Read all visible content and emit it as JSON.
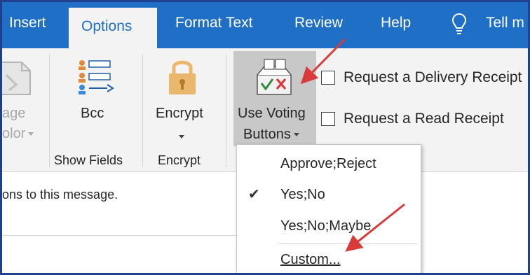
{
  "tabs": [
    {
      "label": "Insert"
    },
    {
      "label": "Options"
    },
    {
      "label": "Format Text"
    },
    {
      "label": "Review"
    },
    {
      "label": "Help"
    }
  ],
  "tell_me": "Tell m",
  "ribbon": {
    "page_color_line1": "age",
    "page_color_line2": "olor",
    "bcc_label": "Bcc",
    "show_fields_group": "Show Fields",
    "encrypt_label": "Encrypt",
    "encrypt_group": "Encrypt",
    "voting_line1": "Use Voting",
    "voting_line2": "Buttons",
    "delivery_receipt": "Request a Delivery Receipt",
    "read_receipt": "Request a Read Receipt"
  },
  "message_body": "ons to this message.",
  "voting_menu": {
    "items": [
      {
        "label": "Approve;Reject",
        "checked": false
      },
      {
        "label": "Yes;No",
        "checked": true
      },
      {
        "label": "Yes;No;Maybe",
        "checked": false
      }
    ],
    "custom_label": "Custom...",
    "check_mark": "✔"
  },
  "colors": {
    "tab_bar": "#1f6fc6",
    "ribbon": "#f3f3f3",
    "arrow": "#d93a3a",
    "lock": "#e9b86c",
    "frame": "#1f3f8f"
  }
}
